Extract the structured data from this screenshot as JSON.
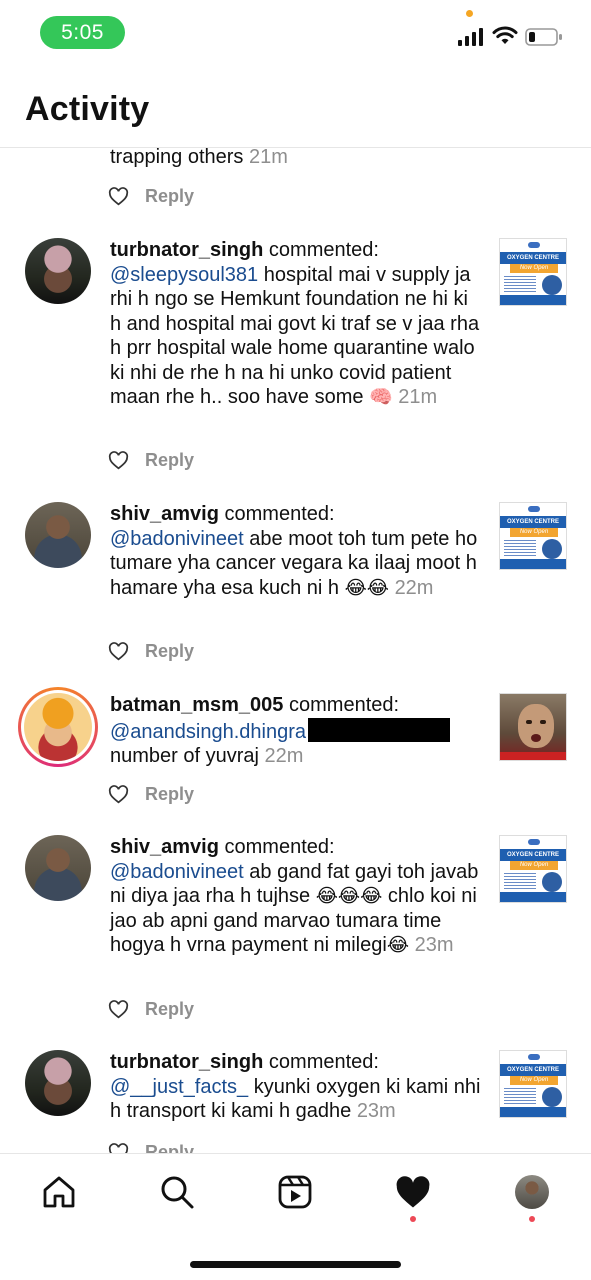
{
  "status_bar": {
    "time": "5:05"
  },
  "header": {
    "title": "Activity"
  },
  "colors": {
    "mention": "#1a4c8f",
    "time_pill": "#34c759",
    "notification_dot": "#ed4956"
  },
  "feed": {
    "partial": {
      "text": "trapping others",
      "time": "21m",
      "reply": "Reply"
    },
    "items": [
      {
        "user": "turbnator_singh",
        "action": "commented:",
        "mention": "@sleepysoul381",
        "body": "hospital mai v supply ja rhi h ngo se Hemkunt foundation ne hi ki h and hospital mai govt ki traf se v jaa rha h prr hospital wale home quarantine walo ki nhi de rhe h na hi unko covid patient maan rhe h.. soo have some",
        "emoji": "🧠",
        "time": "21m",
        "reply": "Reply"
      },
      {
        "user": "shiv_amvig",
        "action": "commented:",
        "mention": "@badonivineet",
        "body": "abe moot toh tum pete ho tumare yha cancer vegara ka ilaaj moot h hamare yha esa kuch ni h",
        "emoji": "😂😂",
        "time": "22m",
        "reply": "Reply"
      },
      {
        "user": "batman_msm_005",
        "action": "commented:",
        "mention": "@anandsingh.dhingra",
        "body": "number of yuvraj",
        "time": "22m",
        "reply": "Reply"
      },
      {
        "user": "shiv_amvig",
        "action": "commented:",
        "mention": "@badonivineet",
        "body_before": "ab gand fat gayi toh javab ni diya jaa rha h tujhse",
        "emoji_mid": "😂😂😂",
        "body_after": "chlo koi ni jao ab apni gand marvao tumara time hogya h vrna payment ni milegi",
        "emoji": "😂",
        "time": "23m",
        "reply": "Reply"
      },
      {
        "user": "turbnator_singh",
        "action": "commented:",
        "mention": "@__just_facts_",
        "body": "kyunki oxygen ki kami nhi h transport ki kami h gadhe",
        "time": "23m",
        "reply": "Reply"
      }
    ]
  },
  "thumbnail": {
    "title": "OXYGEN CENTRE",
    "subtitle": "Now Open"
  },
  "nav": {
    "icons": [
      "home-icon",
      "search-icon",
      "reels-icon",
      "activity-heart-icon",
      "profile-avatar"
    ]
  }
}
